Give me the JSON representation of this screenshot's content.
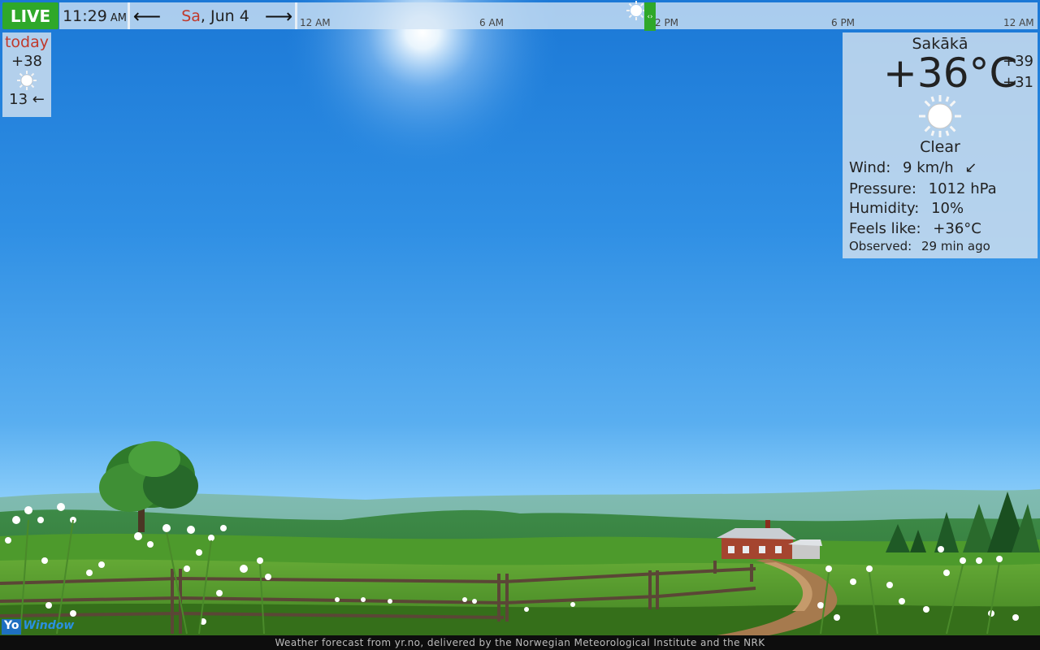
{
  "topbar": {
    "live_label": "LIVE",
    "time": "11:29",
    "time_ampm": "AM",
    "date_day": "Sa",
    "date_rest": ", Jun 4",
    "prev_arrow": "⟵",
    "next_arrow": "⟶",
    "handle_glyph": "‹›",
    "timeline_ticks": [
      "12 AM",
      "6 AM",
      "2 PM",
      "6 PM",
      "12 AM"
    ]
  },
  "daily": {
    "day_label": "today",
    "high": "+38",
    "icon": "sun-icon",
    "wind": "13 ←"
  },
  "current": {
    "location": "Sakākā",
    "temperature": "+36°C",
    "temp_max": "+39",
    "temp_min": "+31",
    "icon": "sun-icon",
    "condition": "Clear",
    "wind_label": "Wind:",
    "wind_value": "9 km/h",
    "wind_dir_glyph": "↙",
    "pressure_label": "Pressure:",
    "pressure_value": "1012 hPa",
    "humidity_label": "Humidity:",
    "humidity_value": "10%",
    "feels_label": "Feels like:",
    "feels_value": "+36°C",
    "observed_label": "Observed:",
    "observed_value": "29 min ago"
  },
  "footer": {
    "credit": "Weather forecast from yr.no, delivered by the Norwegian Meteorological Institute and the NRK",
    "logo_a": "Yo",
    "logo_b": "Window"
  },
  "colors": {
    "live_green": "#2fa82a",
    "day_red": "#c0392b",
    "sky_top": "#1b78d6",
    "sky_bottom": "#9fd8fc"
  }
}
